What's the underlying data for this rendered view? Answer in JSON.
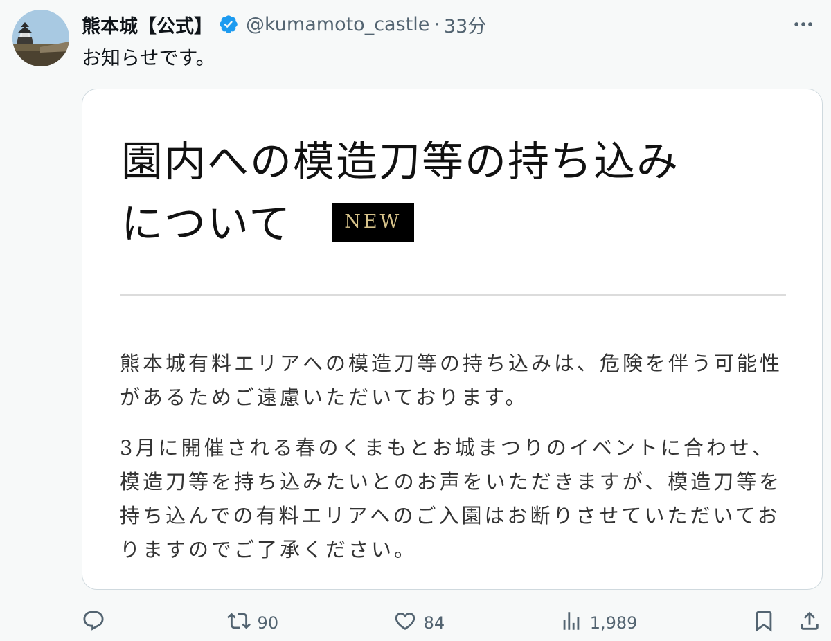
{
  "author": {
    "display_name": "熊本城【公式】",
    "handle": "@kumamoto_castle",
    "separator": "·",
    "time": "33分"
  },
  "tweet": {
    "text": "お知らせです。"
  },
  "card": {
    "title_line1": "園内への模造刀等の持ち込み",
    "title_line2": "について",
    "badge": "NEW",
    "paragraphs": [
      "熊本城有料エリアへの模造刀等の持ち込みは、危険を伴う可能性があるためご遠慮いただいております。",
      "3月に開催される春のくまもとお城まつりのイベントに合わせ、模造刀等を持ち込みたいとのお声をいただきますが、模造刀等を持ち込んでの有料エリアへのご入園はお断りさせていただいておりますのでご了承ください。"
    ]
  },
  "actions": {
    "reply_count": "",
    "retweet_count": "90",
    "like_count": "84",
    "view_count": "1,989"
  },
  "icons": {
    "verified": "verified-badge-icon",
    "more": "more-icon",
    "reply": "reply-icon",
    "retweet": "retweet-icon",
    "like": "heart-icon",
    "views": "views-icon",
    "bookmark": "bookmark-icon",
    "share": "share-icon"
  },
  "colors": {
    "verified": "#1d9bf0",
    "secondary_text": "#536471",
    "badge_bg": "#000000",
    "badge_text": "#d6c28a"
  }
}
